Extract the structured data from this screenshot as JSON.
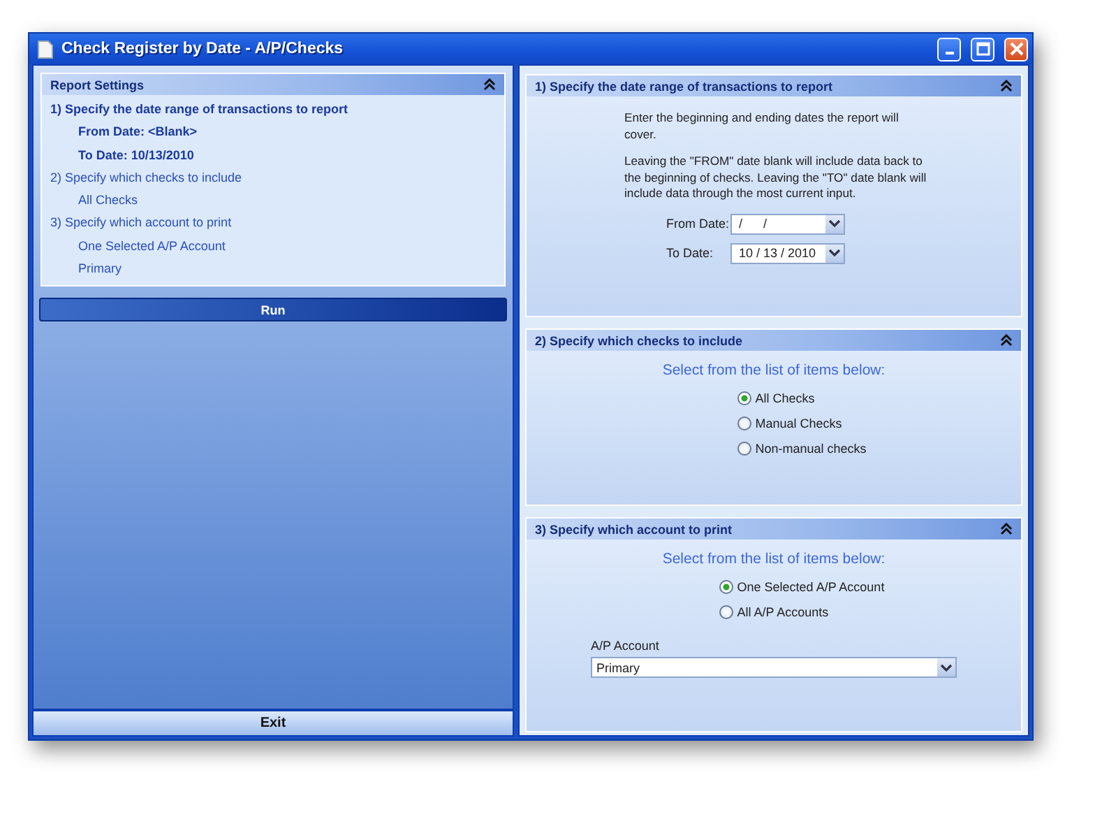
{
  "window": {
    "title": "Check Register by Date - A/P/Checks"
  },
  "summary": {
    "title": "Report Settings",
    "sections": [
      {
        "title": "1)  Specify the date range of transactions to report",
        "active": true,
        "values": [
          "From Date:  <Blank>",
          "To Date:  10/13/2010"
        ]
      },
      {
        "title": "2)  Specify which checks to include",
        "active": false,
        "values": [
          "All Checks"
        ]
      },
      {
        "title": "3)  Specify which account to print",
        "active": false,
        "values": [
          "One Selected A/P Account",
          "Primary"
        ]
      }
    ]
  },
  "run_button": "Run",
  "exit_button": "Exit",
  "panels": [
    {
      "kind": "dates",
      "title": "1)  Specify the date range of transactions to report",
      "paragraphs": [
        "Enter the beginning and ending dates  the report will cover.",
        "Leaving the \"FROM\" date blank will include data back to the beginning of checks.  Leaving the \"TO\" date blank will include data through the most current input."
      ],
      "fields": [
        {
          "label": "From Date:",
          "value": "/      /"
        },
        {
          "label": "To Date:",
          "value": "10 / 13 / 2010"
        }
      ]
    },
    {
      "kind": "choices",
      "title": "2)  Specify which checks to include",
      "prompt": "Select from the list of items below:",
      "options": [
        {
          "label": "All Checks",
          "selected": true
        },
        {
          "label": "Manual Checks",
          "selected": false
        },
        {
          "label": "Non-manual checks",
          "selected": false
        }
      ]
    },
    {
      "kind": "choices",
      "title": "3)  Specify which account to print",
      "prompt": "Select from the list of items below:",
      "options": [
        {
          "label": "One Selected A/P Account",
          "selected": true
        },
        {
          "label": "All A/P Accounts",
          "selected": false
        }
      ],
      "select": {
        "label": "A/P Account",
        "value": "Primary"
      }
    }
  ]
}
